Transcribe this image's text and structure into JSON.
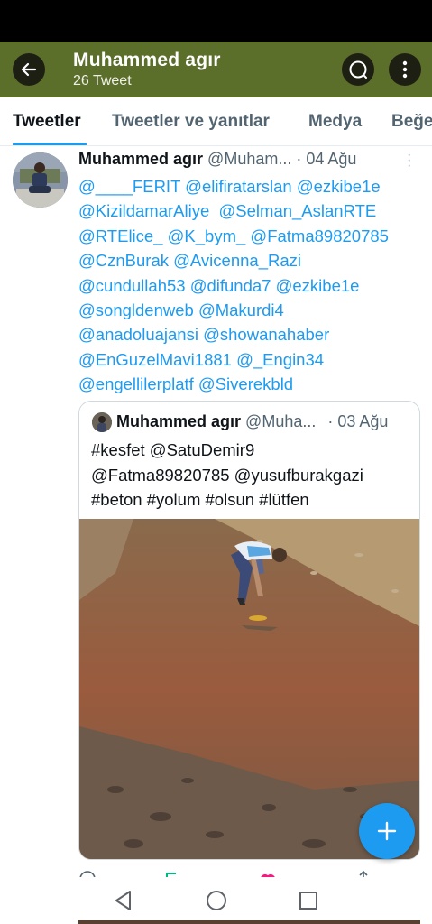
{
  "header": {
    "title": "Muhammed agır",
    "subtitle": "26 Tweet"
  },
  "tabs": [
    {
      "label": "Tweetler",
      "active": true
    },
    {
      "label": "Tweetler ve yanıtlar",
      "active": false
    },
    {
      "label": "Medya",
      "active": false
    },
    {
      "label": "Beğe",
      "active": false
    }
  ],
  "tweet": {
    "name": "Muhammed agır",
    "handle": "@Muham...",
    "date": "· 04 Ağu",
    "mentions": [
      "@____FERIT",
      "@elifiratarslan",
      "@ezkibe1e",
      "@KizildamarAliye",
      "@Selman_AslanRTE",
      "@RTElice_",
      "@K_bym_",
      "@Fatma89820785",
      "@CznBurak",
      "@Avicenna_Razi",
      "@cundullah53",
      "@difunda7",
      "@ezkibe1e",
      "@songldenweb",
      "@Makurdi4",
      "@anadoluajansi",
      "@showanahaber",
      "@EnGuzelMavi1881",
      "@_Engin34",
      "@engellilerplatf",
      "@Siverekbld"
    ],
    "mention_lines": [
      "@____FERIT @elifiratarslan @ezkibe1e",
      "@KizildamarAliye  @Selman_AslanRTE",
      "@RTElice_ @K_bym_ @Fatma89820785",
      "@CznBurak @Avicenna_Razi",
      "@cundullah53 @difunda7 @ezkibe1e",
      "@songldenweb @Makurdi4",
      "@anadoluajansi @showanahaber",
      "@EnGuzelMavi1881 @_Engin34",
      "@engellilerplatf @Siverekbld"
    ]
  },
  "quoted": {
    "name": "Muhammed agır",
    "handle": "@Muha...",
    "date": "· 03 Ağu",
    "lines": [
      "#kesfet @SatuDemir9",
      "@Fatma89820785 @yusufburakgazi",
      "#beton #yolum #olsun #lütfen"
    ]
  },
  "colors": {
    "header_bg": "#5b6e2a",
    "accent": "#1d9bf0",
    "link": "#1d9bf0"
  },
  "icons": [
    "arrow-left-icon",
    "search-icon",
    "more-vertical-icon",
    "plus-icon",
    "back-triangle-icon",
    "home-circle-icon",
    "recents-square-icon"
  ]
}
